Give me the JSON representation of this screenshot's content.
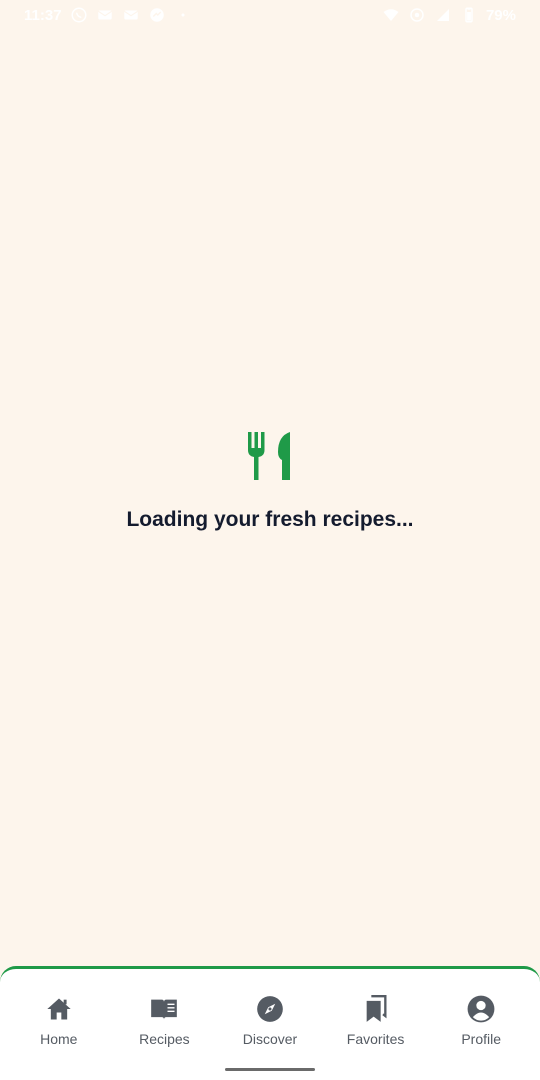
{
  "status_bar": {
    "time": "11:37",
    "battery": "79%",
    "left_icons": [
      "whatsapp-icon",
      "mail-icon",
      "mail-icon",
      "messenger-icon",
      "dot-icon"
    ],
    "right_icons": [
      "wifi-icon",
      "hotspot-icon",
      "signal-icon",
      "battery-icon"
    ]
  },
  "loading": {
    "icon": "fork-knife-icon",
    "text": "Loading your fresh recipes...",
    "accent_color": "#1f9a48"
  },
  "bottom_nav": {
    "items": [
      {
        "label": "Home",
        "icon": "home-icon"
      },
      {
        "label": "Recipes",
        "icon": "book-icon"
      },
      {
        "label": "Discover",
        "icon": "compass-icon"
      },
      {
        "label": "Favorites",
        "icon": "bookmark-icon"
      },
      {
        "label": "Profile",
        "icon": "profile-icon"
      }
    ]
  },
  "colors": {
    "background": "#fdf5ec",
    "text": "#141b2e",
    "nav_icon": "#555b63",
    "accent": "#1f9a48"
  }
}
